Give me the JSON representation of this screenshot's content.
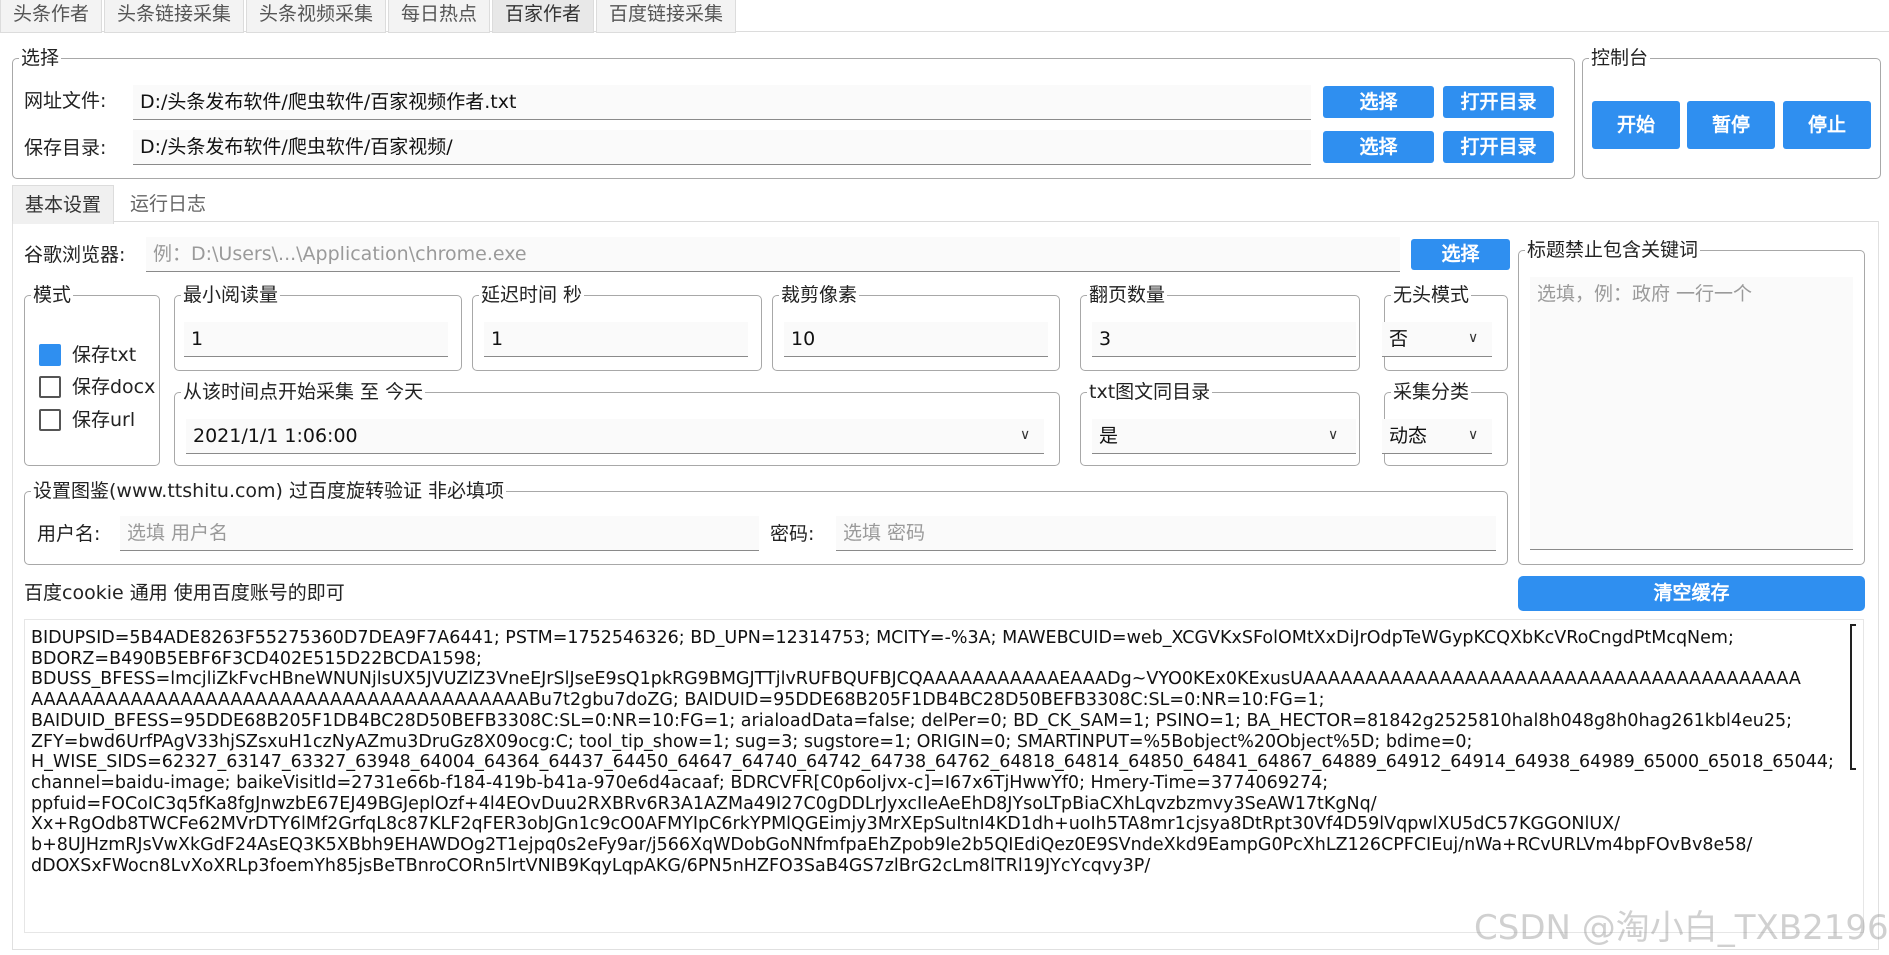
{
  "top_tabs": [
    "头条作者",
    "头条链接采集",
    "头条视频采集",
    "每日热点",
    "百家作者",
    "百度链接采集"
  ],
  "select_group": {
    "legend": "选择",
    "url_file_label": "网址文件:",
    "url_file_value": "D:/头条发布软件/爬虫软件/百家视频作者.txt",
    "save_dir_label": "保存目录:",
    "save_dir_value": "D:/头条发布软件/爬虫软件/百家视频/",
    "choose_label": "选择",
    "open_dir_label": "打开目录"
  },
  "console": {
    "legend": "控制台",
    "start": "开始",
    "pause": "暂停",
    "stop": "停止"
  },
  "sub_tabs": [
    "基本设置",
    "运行日志"
  ],
  "browser": {
    "label": "谷歌浏览器:",
    "placeholder": "例：D:\\Users\\...\\Application\\chrome.exe",
    "choose": "选择"
  },
  "mode": {
    "legend": "模式",
    "options": [
      {
        "label": "保存txt",
        "checked": true
      },
      {
        "label": "保存docx",
        "checked": false
      },
      {
        "label": "保存url",
        "checked": false
      }
    ]
  },
  "min_read": {
    "legend": "最小阅读量",
    "value": "1"
  },
  "delay": {
    "legend": "延迟时间 秒",
    "value": "1"
  },
  "crop": {
    "legend": "裁剪像素",
    "value": "10"
  },
  "pages": {
    "legend": "翻页数量",
    "value": "3"
  },
  "headless": {
    "legend": "无头模式",
    "value": "否"
  },
  "start_time": {
    "legend": "从该时间点开始采集 至 今天",
    "value": "2021/1/1 1:06:00"
  },
  "txt_same_dir": {
    "legend": "txt图文同目录",
    "value": "是"
  },
  "category": {
    "legend": "采集分类",
    "value": "动态"
  },
  "keywords": {
    "legend": "标题禁止包含关键词",
    "placeholder": "选填，例：政府 一行一个"
  },
  "ttshitu": {
    "legend": "设置图鉴(www.ttshitu.com) 过百度旋转验证 非必填项",
    "user_label": "用户名:",
    "user_placeholder": "选填 用户名",
    "pass_label": "密码:",
    "pass_placeholder": "选填 密码"
  },
  "cookie": {
    "label": "百度cookie 通用 使用百度账号的即可",
    "clear": "清空缓存",
    "text": "BIDUPSID=5B4ADE8263F55275360D7DEA9F7A6441; PSTM=1752546326; BD_UPN=12314753; MCITY=-%3A; MAWEBCUID=web_XCGVKxSFolOMtXxDiJrOdpTeWGypKCQXbKcVRoCngdPtMcqNem;\nBDORZ=B490B5EBF6F3CD402E515D22BCDA1598;\nBDUSS_BFESS=lmcjliZkFvcHBneWNUNjlsUX5JVUZlZ3VneEJrSlJseE9sQ1pkRG9BMGJTTjlvRUFBQUFBJCQAAAAAAAAAAAEAAADg~VYO0KEx0KExusUAAAAAAAAAAAAAAAAAAAAAAAAAAAAAAAAAAAAAAAA\nAAAAAAAAAAAAAAAAAAAAAAAAAAAAAAAAAAAAAAAABu7t2gbu7doZG; BAIDUID=95DDE68B205F1DB4BC28D50BEFB3308C:SL=0:NR=10:FG=1;\nBAIDUID_BFESS=95DDE68B205F1DB4BC28D50BEFB3308C:SL=0:NR=10:FG=1; arialoadData=false; delPer=0; BD_CK_SAM=1; PSINO=1; BA_HECTOR=81842g2525810hal8h048g8h0hag261kbl4eu25;\nZFY=bwd6UrfPAgV33hjSZsxuH1czNyAZmu3DruGz8X09ocg:C; tool_tip_show=1; sug=3; sugstore=1; ORIGIN=0; SMARTINPUT=%5Bobject%20Object%5D; bdime=0;\nH_WISE_SIDS=62327_63147_63327_63948_64004_64364_64437_64450_64647_64740_64742_64738_64762_64818_64814_64850_64841_64867_64889_64912_64914_64938_64989_65000_65018_65044;\nchannel=baidu-image; baikeVisitId=2731e66b-f184-419b-b41a-970e6d4acaaf; BDRCVFR[C0p6oIjvx-c]=I67x6TjHwwYf0; Hmery-Time=3774069274;\nppfuid=FOCoIC3q5fKa8fgJnwzbE67EJ49BGJeplOzf+4l4EOvDuu2RXBRv6R3A1AZMa49I27C0gDDLrJyxcIIeAeEhD8JYsoLTpBiaCXhLqvzbzmvy3SeAW17tKgNq/\nXx+RgOdb8TWCFe62MVrDTY6lMf2GrfqL8c87KLF2qFER3obJGn1c9cO0AFMYIpC6rkYPMlQGEimjy3MrXEpSuItnI4KD1dh+uoIh5TA8mr1cjsya8DtRpt30Vf4D59lVqpwlXU5dC57KGGONlUX/\nb+8UJHzmRJsVwXkGdF24AsEQ3K5XBbh9EHAWDOg2T1ejpq0s2eFy9ar/j566XqWDobGoNNfmfpaEhZpob9le2b5QIEdiQez0E9SVndeXkd9EampG0PcXhLZ126CPFCIEuj/nWa+RCvURLVm4bpFOvBv8e58/\ndDOXSxFWocn8LvXoXRLp3foemYh85jsBeTBnroCORn5lrtVNIB9KqyLqpAKG/6PN5nHZFO3SaB4GS7zlBrG2cLm8lTRl19JYcYcqvy3P/"
  },
  "watermark": "CSDN @淘小白_TXB2196"
}
